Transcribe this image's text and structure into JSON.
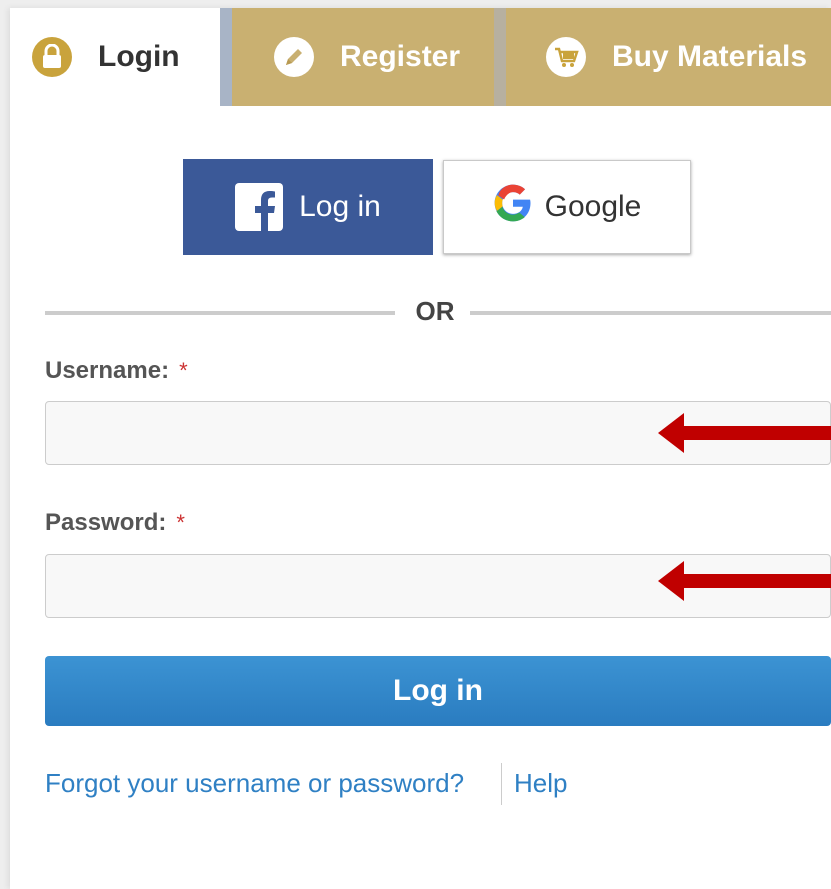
{
  "tabs": {
    "login": {
      "label": "Login",
      "icon": "lock-icon"
    },
    "register": {
      "label": "Register",
      "icon": "pencil-icon"
    },
    "buy": {
      "label": "Buy Materials",
      "icon": "cart-icon"
    }
  },
  "social": {
    "facebook_label": "Log in",
    "google_label": "Google"
  },
  "divider_text": "OR",
  "form": {
    "username_label": "Username:",
    "username_value": "",
    "password_label": "Password:",
    "password_value": "",
    "required_marker": "*",
    "submit_label": "Log in"
  },
  "links": {
    "forgot": "Forgot your username or password?",
    "help": "Help"
  },
  "colors": {
    "tab_gold": "#c9b071",
    "facebook_blue": "#3b5998",
    "primary_blue": "#2f80c4",
    "annotation_arrow": "#c00000",
    "required_red": "#cc3333"
  }
}
